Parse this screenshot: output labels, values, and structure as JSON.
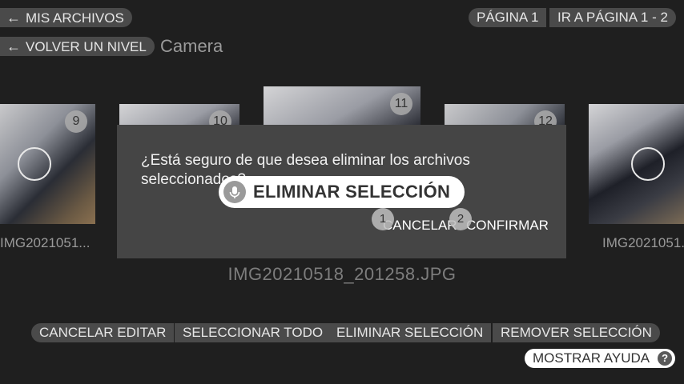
{
  "nav": {
    "my_files": "MIS ARCHIVOS",
    "up_level": "VOLVER UN NIVEL",
    "folder": "Camera",
    "page": "PÁGINA 1",
    "goto_page": "IR A PÁGINA 1 - 2"
  },
  "thumbnails": [
    {
      "number": "9",
      "caption": "IMG2021051..."
    },
    {
      "number": "10"
    },
    {
      "number": "11"
    },
    {
      "number": "12"
    },
    {
      "number": "",
      "caption": "IMG2021051..."
    }
  ],
  "current_file": "IMG20210518_201258.JPG",
  "dialog": {
    "message": "¿Está seguro de que desea eliminar los archivos seleccionados?",
    "cancel": "CANCELAR",
    "confirm": "CONFIRMAR",
    "cancel_badge": "1",
    "confirm_badge": "2"
  },
  "voice": {
    "icon": "microphone-icon",
    "label": "ELIMINAR SELECCIÓN"
  },
  "toolbar": {
    "cancel_edit": "CANCELAR EDITAR",
    "select_all": "SELECCIONAR TODO",
    "delete_selection": "ELIMINAR SELECCIÓN",
    "remove_selection": "REMOVER SELECCIÓN"
  },
  "help": {
    "label": "MOSTRAR AYUDA",
    "icon": "?"
  }
}
